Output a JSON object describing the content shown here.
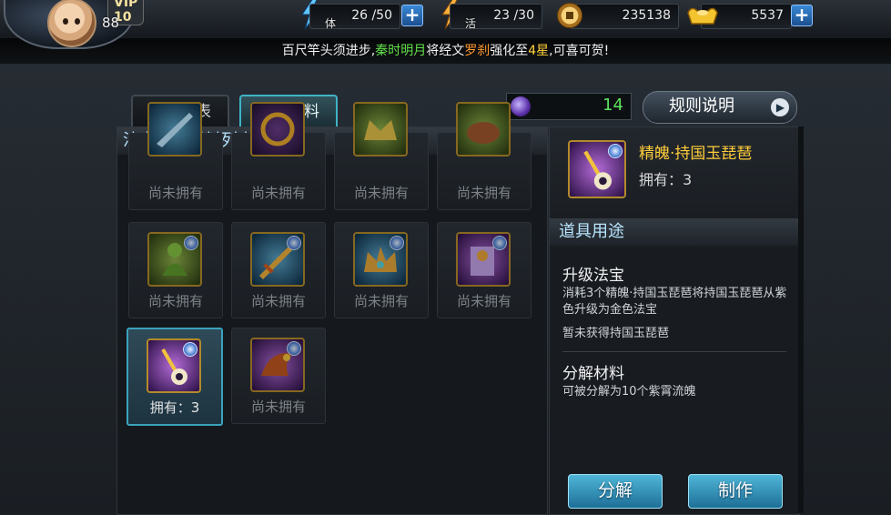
{
  "player": {
    "vip": "VIP 10",
    "level": "88"
  },
  "resources": {
    "stamina": {
      "label": "体",
      "value": "26 /50"
    },
    "energy": {
      "label": "活",
      "value": "23 /30"
    },
    "coins": {
      "value": "235138"
    },
    "ingots": {
      "value": "5537"
    }
  },
  "ticker": {
    "p1": "百尺竿头须进步,",
    "name": "秦时明月",
    "p2": "将经文",
    "item": "罗刹",
    "p3": "强化至",
    "stars": "4星",
    "p4": ",可喜可贺!"
  },
  "tabs": [
    {
      "label": "法宝列表",
      "active": false
    },
    {
      "label": "升级材料",
      "active": true
    }
  ],
  "orb_count": "14",
  "rules_button": "规则说明",
  "list": {
    "header": "法宝升级材料列表",
    "items": [
      {
        "label": "尚未拥有",
        "icon": "blue-blade-icon",
        "owned": false
      },
      {
        "label": "尚未拥有",
        "icon": "golden-ring-icon",
        "owned": false
      },
      {
        "label": "尚未拥有",
        "icon": "green-crown-icon",
        "owned": false
      },
      {
        "label": "尚未拥有",
        "icon": "green-beast-icon",
        "owned": false
      },
      {
        "label": "尚未拥有",
        "icon": "jade-buddha-icon",
        "owned": false
      },
      {
        "label": "尚未拥有",
        "icon": "golden-sword-icon",
        "owned": false
      },
      {
        "label": "尚未拥有",
        "icon": "dragon-crown-icon",
        "owned": false
      },
      {
        "label": "尚未拥有",
        "icon": "demon-banner-icon",
        "owned": false
      },
      {
        "label": "拥有：3",
        "icon": "pipa-icon",
        "owned": true
      },
      {
        "label": "尚未拥有",
        "icon": "purple-dragon-icon",
        "owned": false
      }
    ]
  },
  "detail": {
    "name": "精魄·持国玉琵琶",
    "owned": "拥有：3",
    "section_title": "道具用途",
    "upgrade_title": "升级法宝",
    "upgrade_desc": "消耗3个精魄·持国玉琵琶将持国玉琵琶从紫色升级为金色法宝",
    "not_obtained": "暂未获得持国玉琵琶",
    "decompose_title": "分解材料",
    "decompose_desc": "可被分解为10个紫霄流魄"
  },
  "buttons": {
    "decompose": "分解",
    "craft": "制作"
  },
  "colors": {
    "accent_teal": "#3fb3c6",
    "gold_text": "#ffcd3a",
    "green_text": "#5be35b",
    "ticker_name": "#62e24a",
    "ticker_item": "#ff9a2e",
    "ticker_stars": "#ffd23a"
  }
}
